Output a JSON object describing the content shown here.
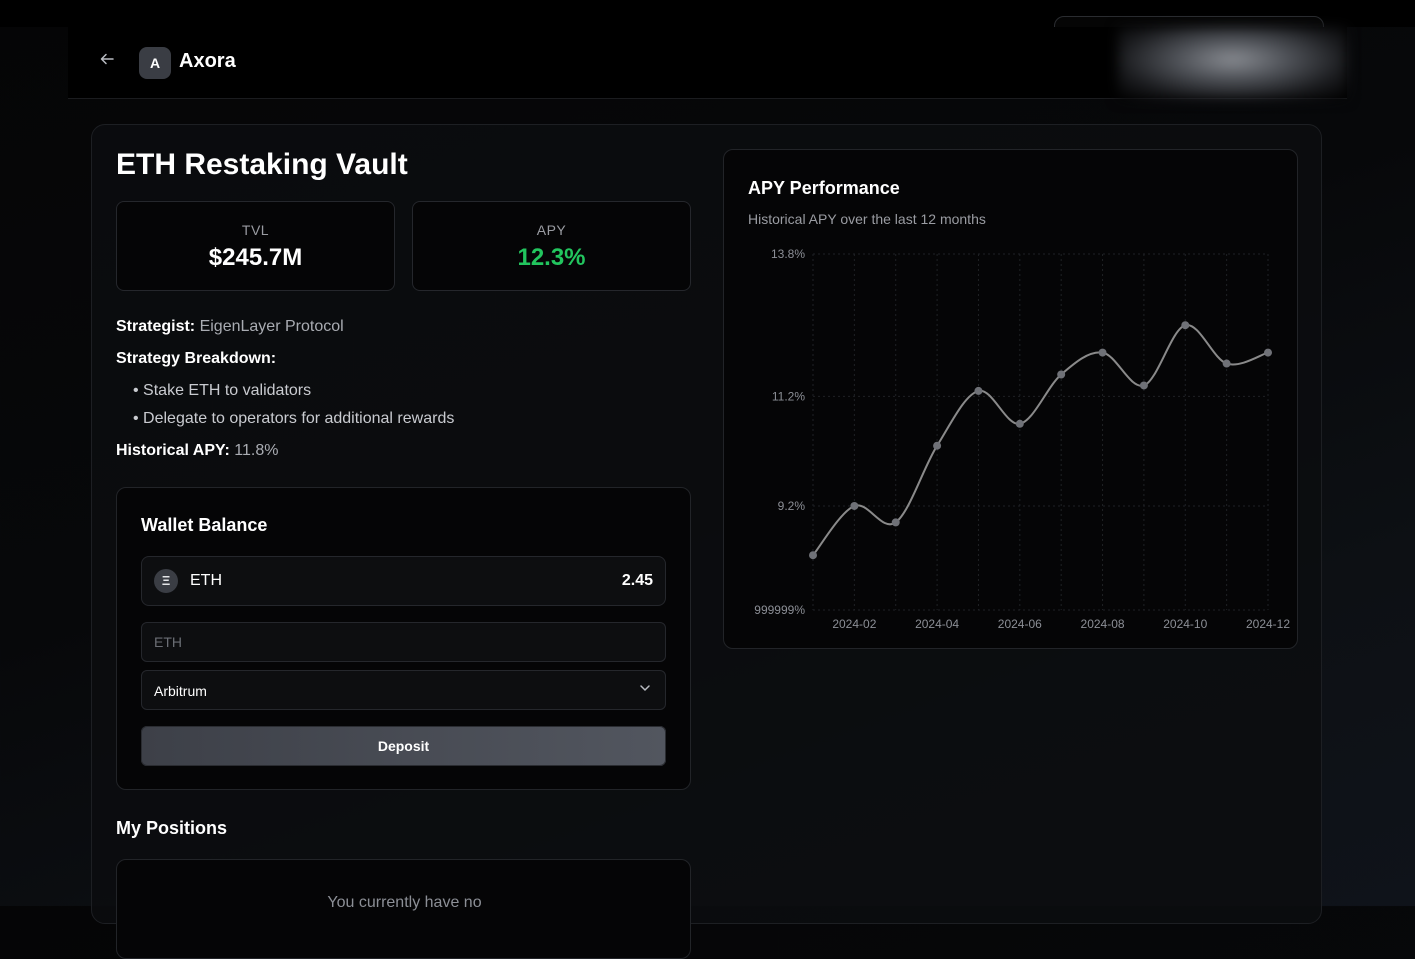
{
  "header": {
    "back_icon": "arrow-left-icon",
    "logo_letter": "A",
    "brand_name": "Axora"
  },
  "vault": {
    "title": "ETH Restaking Vault",
    "tvl_label": "TVL",
    "tvl_value": "$245.7M",
    "apy_label": "APY",
    "apy_value": "12.3%",
    "strategist_label": "Strategist:",
    "strategist_value": "EigenLayer Protocol",
    "breakdown_label": "Strategy Breakdown:",
    "breakdown_items": [
      "Stake ETH to validators",
      "Delegate to operators for additional rewards"
    ],
    "historical_label": "Historical APY:",
    "historical_value": "11.8%"
  },
  "wallet": {
    "title": "Wallet Balance",
    "asset_icon": "Ξ",
    "asset_name": "ETH",
    "asset_balance": "2.45",
    "amount_placeholder": "ETH",
    "chain_selected": "Arbitrum",
    "deposit_label": "Deposit"
  },
  "positions": {
    "title": "My Positions",
    "empty_text": "You currently have no"
  },
  "chart": {
    "title": "APY Performance",
    "subtitle": "Historical APY over the last 12 months"
  },
  "colors": {
    "accent_green": "#22c55e",
    "line": "#8a8a8a"
  },
  "chart_data": {
    "type": "line",
    "title": "APY Performance",
    "subtitle": "Historical APY over the last 12 months",
    "x": [
      "2024-01",
      "2024-02",
      "2024-03",
      "2024-04",
      "2024-05",
      "2024-06",
      "2024-07",
      "2024-08",
      "2024-09",
      "2024-10",
      "2024-11",
      "2024-12"
    ],
    "x_tick_labels": [
      "2024-02",
      "2024-04",
      "2024-06",
      "2024-08",
      "2024-10",
      "2024-12"
    ],
    "y_tick_labels": [
      "13.8%",
      "11.2%",
      "9.2%",
      "999999%"
    ],
    "y_ticks": [
      13.8,
      11.2,
      9.2,
      7.3
    ],
    "ylim": [
      7.3,
      13.8
    ],
    "series": [
      {
        "values": [
          8.3,
          9.2,
          8.9,
          10.3,
          11.3,
          10.7,
          11.6,
          12.0,
          11.4,
          12.5,
          11.8,
          12.0
        ]
      }
    ],
    "grid": true,
    "legend": "none"
  }
}
